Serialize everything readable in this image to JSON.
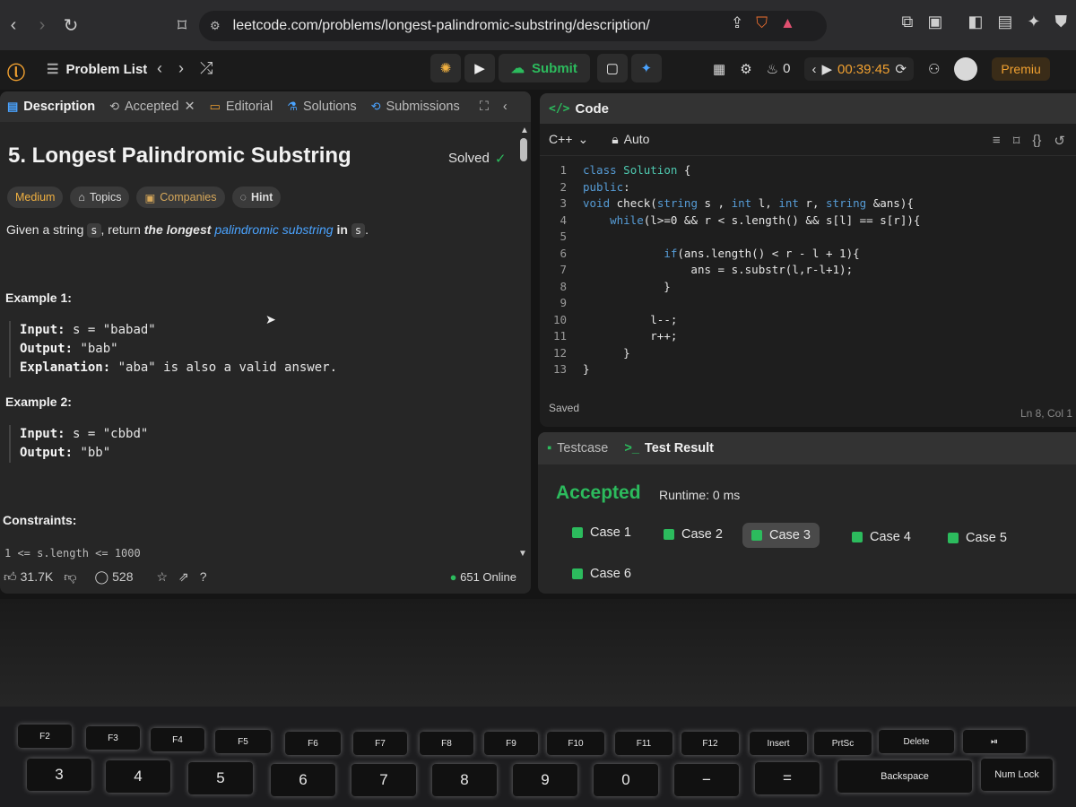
{
  "browser": {
    "url": "leetcode.com/problems/longest-palindromic-substring/description/"
  },
  "topbar": {
    "problem_list": "Problem List",
    "submit": "Submit",
    "streak": "0",
    "timer": "00:39:45",
    "premium": "Premiu"
  },
  "left_tabs": [
    "Description",
    "Accepted",
    "Editorial",
    "Solutions",
    "Submissions"
  ],
  "problem": {
    "title": "5. Longest Palindromic Substring",
    "status": "Solved",
    "tags": [
      "Medium",
      "Topics",
      "Companies",
      "Hint"
    ],
    "desc_given": "Given a string",
    "desc_s": "s",
    "desc_return": ", return",
    "desc_longest": "the longest",
    "desc_link": "palindromic substring",
    "desc_in": "in",
    "desc_s2": "s",
    "desc_dot": ".",
    "example1_title": "Example 1:",
    "example1": {
      "input_label": "Input:",
      "input": "s = \"babad\"",
      "output_label": "Output:",
      "output": "\"bab\"",
      "expl_label": "Explanation:",
      "expl": "\"aba\" is also a valid answer."
    },
    "example2_title": "Example 2:",
    "example2": {
      "input_label": "Input:",
      "input": "s = \"cbbd\"",
      "output_label": "Output:",
      "output": "\"bb\""
    },
    "constraints_title": "Constraints:",
    "constraint_partial": "1 <= s.length <= 1000"
  },
  "footer": {
    "likes": "31.7K",
    "comments": "528",
    "online": "651 Online"
  },
  "code": {
    "header": "Code",
    "language": "C++",
    "mode": "Auto",
    "lines": [
      "class Solution {",
      "public:",
      "void check(string s , int l, int r, string &ans){",
      "    while(l>=0 && r < s.length() && s[l] == s[r]){",
      "",
      "            if(ans.length() < r - l + 1){",
      "                ans = s.substr(l,r-l+1);",
      "            }",
      "",
      "          l--;",
      "          r++;",
      "      }",
      "}"
    ],
    "saved": "Saved",
    "position": "Ln 8, Col 1"
  },
  "result": {
    "tabs": [
      "Testcase",
      "Test Result"
    ],
    "status": "Accepted",
    "runtime": "Runtime: 0 ms",
    "cases": [
      "Case 1",
      "Case 2",
      "Case 3",
      "Case 4",
      "Case 5",
      "Case 6"
    ],
    "active_case": "Case 3"
  },
  "colors": {
    "accent_green": "#2cbb5d",
    "accent_orange": "#f0a030",
    "panel": "#262626"
  }
}
